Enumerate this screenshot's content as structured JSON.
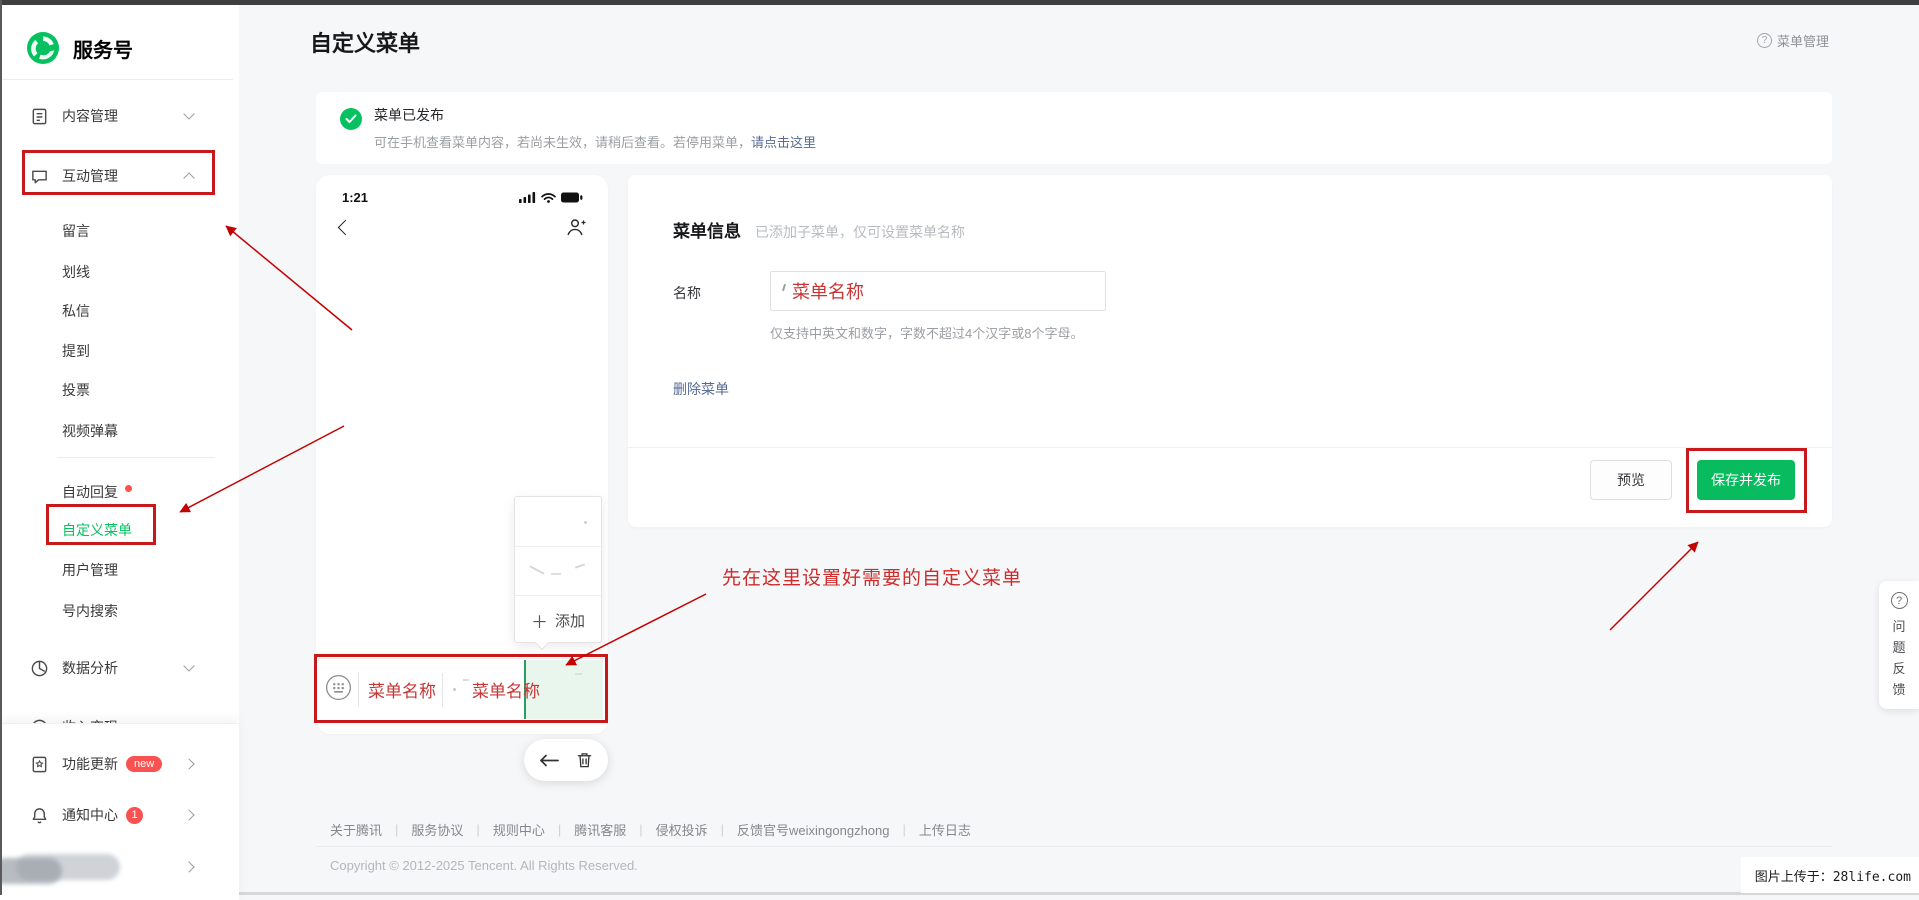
{
  "sidebar": {
    "logo_label": "服务号",
    "content_mgmt": "内容管理",
    "interact_mgmt": "互动管理",
    "sub_items": [
      "留言",
      "划线",
      "私信",
      "提到",
      "投票",
      "视频弹幕"
    ],
    "auto_reply": "自动回复",
    "custom_menu": "自定义菜单",
    "user_mgmt": "用户管理",
    "account_search": "号内搜索",
    "data_analysis": "数据分析",
    "income": "收入变现",
    "feature_update": "功能更新",
    "feature_badge": "new",
    "notify_center": "通知中心",
    "notify_badge": "1"
  },
  "header": {
    "title": "自定义菜单",
    "help_icon": "?",
    "help_label": "菜单管理"
  },
  "banner": {
    "title": "菜单已发布",
    "desc": "可在手机查看菜单内容，若尚未生效，请稍后查看。若停用菜单，",
    "link_label": "请点击这里"
  },
  "phone": {
    "time": "1:21",
    "menu_item_1": "菜单名称",
    "menu_item_2": "菜单名称",
    "popup_add_icon": "＋",
    "popup_add_label": "添加"
  },
  "form": {
    "title": "菜单信息",
    "subtitle": "已添加子菜单，仅可设置菜单名称",
    "name_label": "名称",
    "name_value": "菜单名称",
    "hint": "仅支持中英文和数字，字数不超过4个汉字或8个字母。",
    "delete_label": "删除菜单"
  },
  "actions": {
    "preview": "预览",
    "save_publish": "保存并发布"
  },
  "annotation": {
    "tip": "先在这里设置好需要的自定义菜单"
  },
  "feedback": {
    "icon": "?",
    "label": "问题反馈"
  },
  "footer": {
    "links": [
      "关于腾讯",
      "服务协议",
      "规则中心",
      "腾讯客服",
      "侵权投诉",
      "反馈官号weixingongzhong",
      "上传日志"
    ],
    "separator": "|",
    "copyright": "Copyright © 2012-2025 Tencent. All Rights Reserved."
  },
  "watermark": "图片上传于：28life.com"
}
